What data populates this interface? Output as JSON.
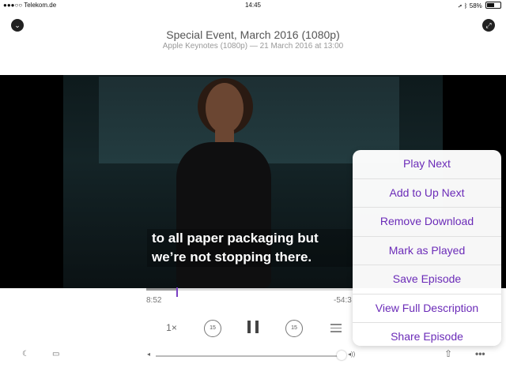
{
  "status_bar": {
    "carrier": "●●●○○ Telekom.de",
    "wifi_icon": "wifi-icon",
    "time": "14:45",
    "location_icon": "location-arrow-icon",
    "bluetooth_icon": "bluetooth-icon",
    "battery_label": "58%",
    "battery_level": 0.58
  },
  "header": {
    "collapse_icon": "chevron-down-icon",
    "title": "Special Event, March 2016 (1080p)",
    "subtitle": "Apple Keynotes (1080p) — 21 March 2016 at 13:00",
    "fullscreen_icon": "expand-arrows-icon"
  },
  "video": {
    "subtitle_line1": "to all paper packaging but",
    "subtitle_line2": "we’re not stopping there."
  },
  "playback": {
    "elapsed": "8:52",
    "remaining": "-54:3",
    "progress": 0.14,
    "speed_label": "1×",
    "skip_back_label": "15",
    "skip_forward_label": "15",
    "pause_icon": "pause-icon",
    "up_next_icon": "list-icon"
  },
  "bottom_bar": {
    "sleep_timer_icon": "moon-icon",
    "airplay_icon": "airplay-icon",
    "volume_low_icon": "speaker-low-icon",
    "volume_high_icon": "speaker-high-icon",
    "volume_level": 0.98,
    "share_icon": "share-icon",
    "more_icon": "more-icon"
  },
  "context_menu": {
    "items": [
      {
        "label": "Play Next"
      },
      {
        "label": "Add to Up Next"
      },
      {
        "label": "Remove Download"
      },
      {
        "label": "Mark as Played"
      },
      {
        "label": "Save Episode"
      },
      {
        "label": "View Full Description"
      },
      {
        "label": "Share Episode"
      }
    ]
  },
  "colors": {
    "accent": "#6b2bb8",
    "video_background": "#000000"
  }
}
